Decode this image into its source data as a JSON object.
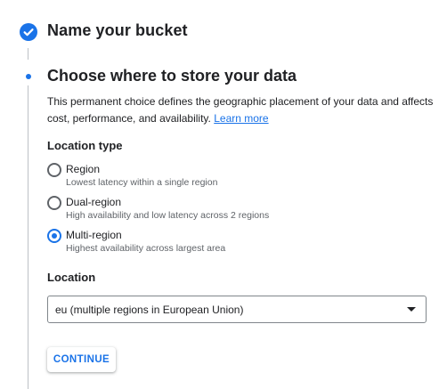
{
  "stepper": {
    "step1": {
      "title": "Name your bucket",
      "status": "completed",
      "icon": "check-circle-icon"
    },
    "step2": {
      "title": "Choose where to store your data",
      "status": "active",
      "description": "This permanent choice defines the geographic placement of your data and affects cost, performance, and availability.",
      "learn_more": "Learn more"
    }
  },
  "location_type": {
    "label": "Location type",
    "options": [
      {
        "label": "Region",
        "sublabel": "Lowest latency within a single region",
        "selected": false
      },
      {
        "label": "Dual-region",
        "sublabel": "High availability and low latency across 2 regions",
        "selected": false
      },
      {
        "label": "Multi-region",
        "sublabel": "Highest availability across largest area",
        "selected": true
      }
    ]
  },
  "location": {
    "label": "Location",
    "selected_value": "eu (multiple regions in European Union)"
  },
  "continue_label": "CONTINUE",
  "colors": {
    "accent": "#1a73e8",
    "text_primary": "#202124",
    "text_secondary": "#5f6368"
  }
}
